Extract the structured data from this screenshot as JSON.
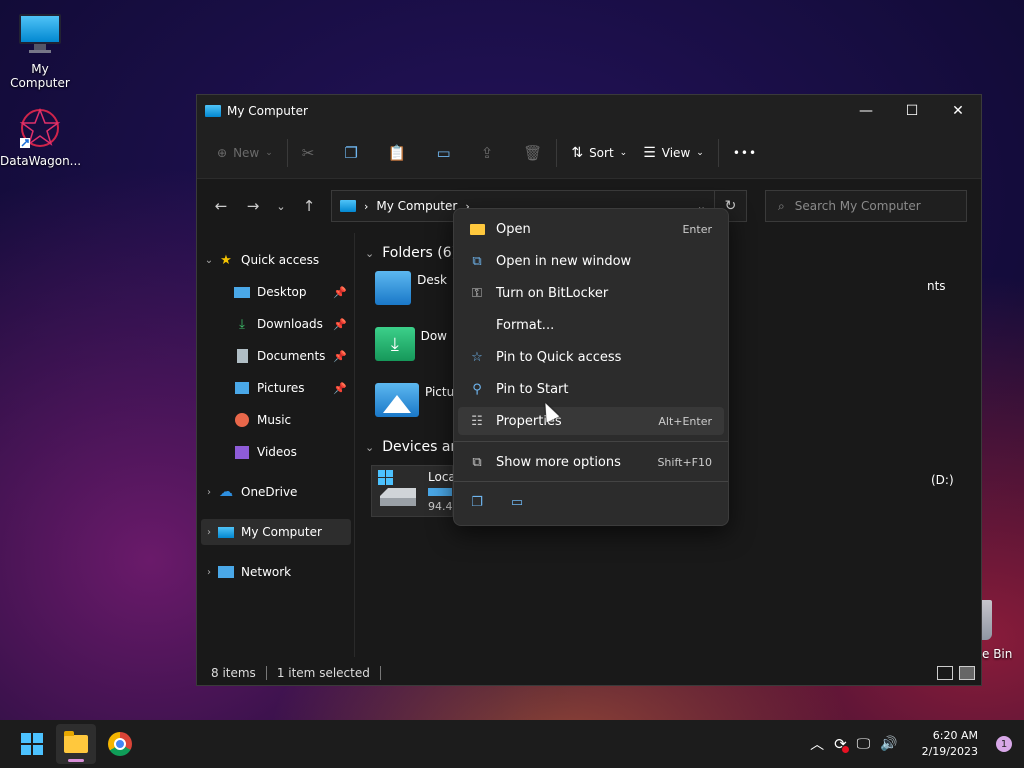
{
  "desktop": {
    "icons": [
      {
        "label": "My Computer"
      },
      {
        "label": "DataWagon..."
      }
    ],
    "recycle_bin_partial_label": "e Bin"
  },
  "window": {
    "title": "My Computer",
    "controls": {
      "minimize": "—",
      "maximize": "☐",
      "close": "✕"
    }
  },
  "toolbar": {
    "new_label": "New",
    "sort_label": "Sort",
    "view_label": "View",
    "more_label": "•••"
  },
  "address": {
    "path_label": "My Computer",
    "search_placeholder": "Search My Computer"
  },
  "nav_pane": {
    "items": [
      {
        "label": "Quick access"
      },
      {
        "label": "Desktop"
      },
      {
        "label": "Downloads"
      },
      {
        "label": "Documents"
      },
      {
        "label": "Pictures"
      },
      {
        "label": "Music"
      },
      {
        "label": "Videos"
      },
      {
        "label": "OneDrive"
      },
      {
        "label": "My Computer"
      },
      {
        "label": "Network"
      }
    ]
  },
  "content": {
    "folders_header": "Folders (6)",
    "folders": [
      {
        "label": "Desk"
      },
      {
        "label": "Dow"
      },
      {
        "label": "Pictu"
      }
    ],
    "folders_right_partial": "nts",
    "devices_header": "Devices and",
    "drive": {
      "label": "Loca",
      "size": "94.4"
    },
    "drive_d_partial": "(D:)"
  },
  "context_menu": {
    "items": [
      {
        "label": "Open",
        "shortcut": "Enter"
      },
      {
        "label": "Open in new window",
        "shortcut": ""
      },
      {
        "label": "Turn on BitLocker",
        "shortcut": ""
      },
      {
        "label": "Format...",
        "shortcut": ""
      },
      {
        "label": "Pin to Quick access",
        "shortcut": ""
      },
      {
        "label": "Pin to Start",
        "shortcut": ""
      },
      {
        "label": "Properties",
        "shortcut": "Alt+Enter"
      },
      {
        "label": "Show more options",
        "shortcut": "Shift+F10"
      }
    ]
  },
  "statusbar": {
    "items_count": "8 items",
    "selection": "1 item selected"
  },
  "taskbar": {
    "time": "6:20 AM",
    "date": "2/19/2023",
    "notification_count": "1"
  }
}
